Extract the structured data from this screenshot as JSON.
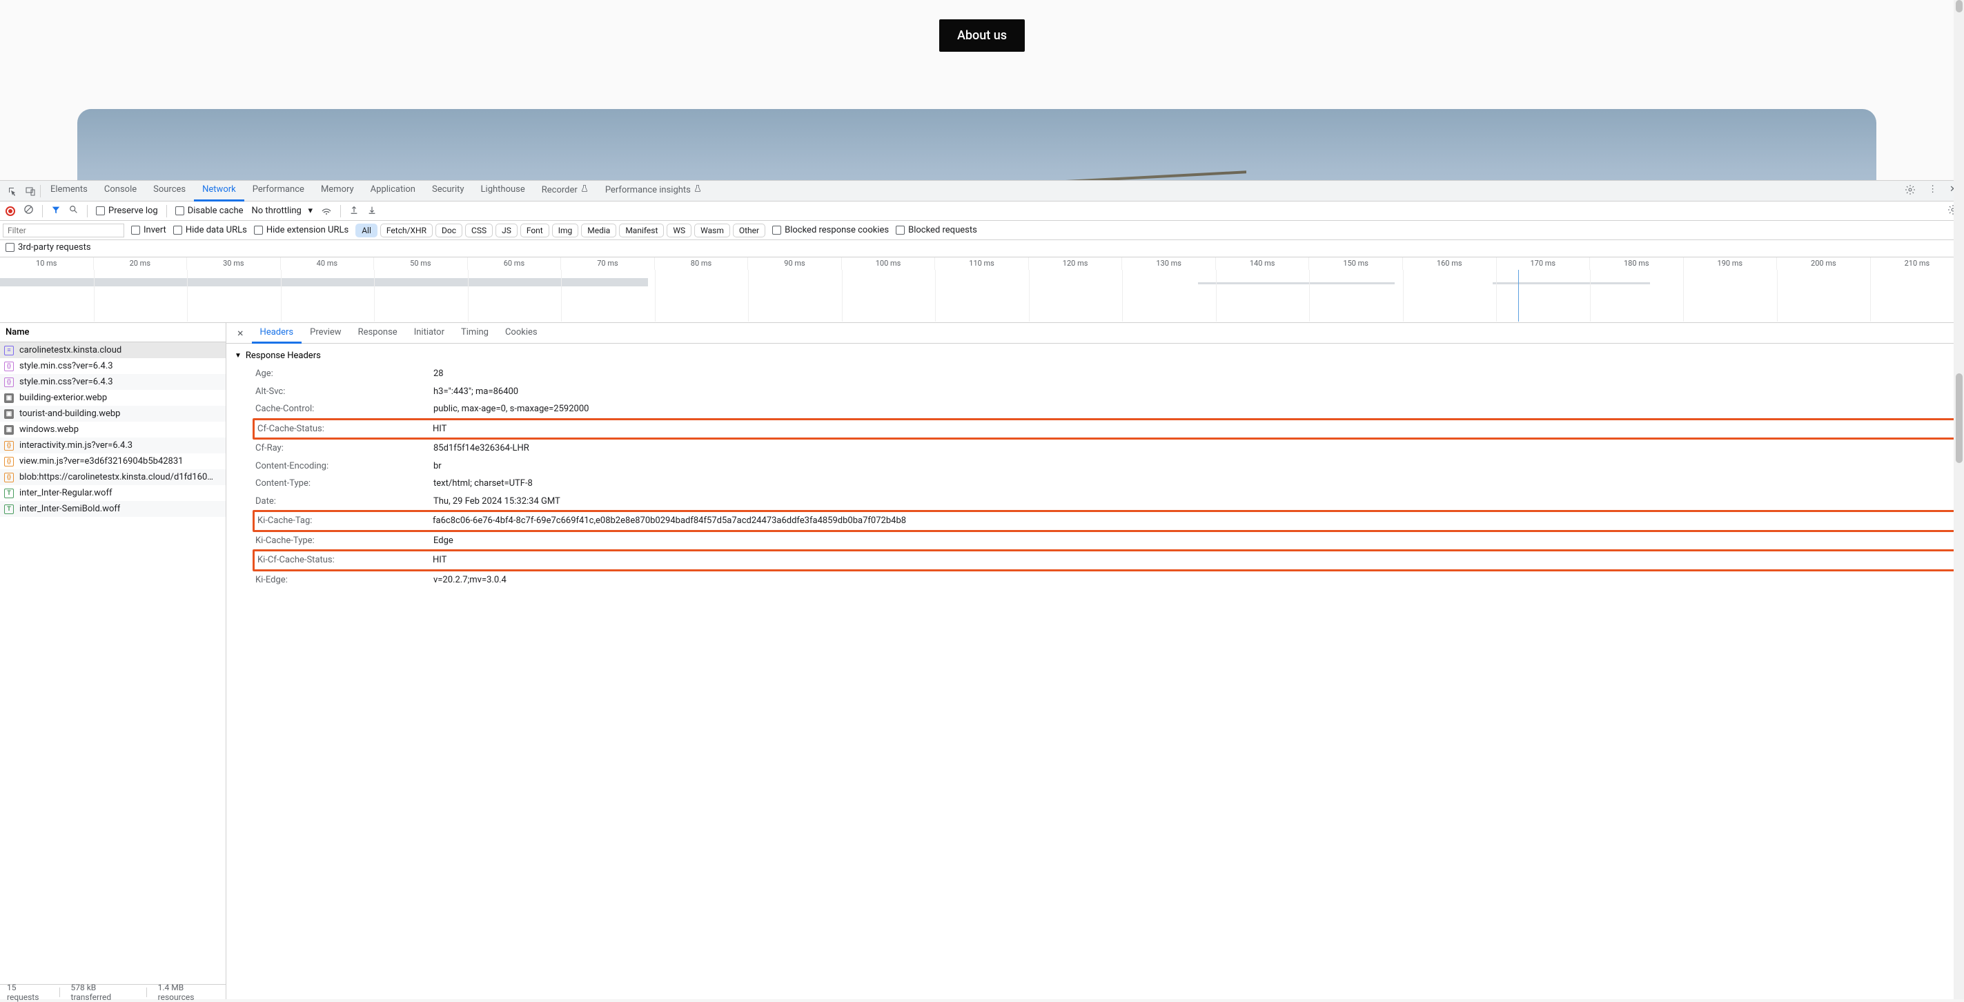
{
  "page": {
    "about_button": "About us"
  },
  "devtools": {
    "tabs": [
      "Elements",
      "Console",
      "Sources",
      "Network",
      "Performance",
      "Memory",
      "Application",
      "Security",
      "Lighthouse",
      "Recorder",
      "Performance insights"
    ],
    "active_tab": "Network"
  },
  "toolbar": {
    "preserve_log": "Preserve log",
    "disable_cache": "Disable cache",
    "throttling": "No throttling"
  },
  "filter": {
    "placeholder": "Filter",
    "invert": "Invert",
    "hide_data": "Hide data URLs",
    "hide_ext": "Hide extension URLs",
    "types": [
      "All",
      "Fetch/XHR",
      "Doc",
      "CSS",
      "JS",
      "Font",
      "Img",
      "Media",
      "Manifest",
      "WS",
      "Wasm",
      "Other"
    ],
    "active_type": "All",
    "blocked_cookies": "Blocked response cookies",
    "blocked_requests": "Blocked requests",
    "third_party": "3rd-party requests"
  },
  "timeline": {
    "ticks": [
      "10 ms",
      "20 ms",
      "30 ms",
      "40 ms",
      "50 ms",
      "60 ms",
      "70 ms",
      "80 ms",
      "90 ms",
      "100 ms",
      "110 ms",
      "120 ms",
      "130 ms",
      "140 ms",
      "150 ms",
      "160 ms",
      "170 ms",
      "180 ms",
      "190 ms",
      "200 ms",
      "210 ms"
    ]
  },
  "requests": {
    "header": "Name",
    "items": [
      {
        "type": "doc",
        "name": "carolinetestx.kinsta.cloud"
      },
      {
        "type": "css",
        "name": "style.min.css?ver=6.4.3"
      },
      {
        "type": "css",
        "name": "style.min.css?ver=6.4.3"
      },
      {
        "type": "img",
        "name": "building-exterior.webp"
      },
      {
        "type": "img",
        "name": "tourist-and-building.webp"
      },
      {
        "type": "img",
        "name": "windows.webp"
      },
      {
        "type": "js",
        "name": "interactivity.min.js?ver=6.4.3"
      },
      {
        "type": "js",
        "name": "view.min.js?ver=e3d6f3216904b5b42831"
      },
      {
        "type": "js",
        "name": "blob:https://carolinetestx.kinsta.cloud/d1fd160…"
      },
      {
        "type": "font",
        "name": "inter_Inter-Regular.woff"
      },
      {
        "type": "font",
        "name": "inter_Inter-SemiBold.woff"
      }
    ]
  },
  "status": {
    "requests": "15 requests",
    "transferred": "578 kB transferred",
    "resources": "1.4 MB resources"
  },
  "details": {
    "tabs": [
      "Headers",
      "Preview",
      "Response",
      "Initiator",
      "Timing",
      "Cookies"
    ],
    "active": "Headers",
    "section_title": "Response Headers",
    "headers": [
      {
        "k": "Age:",
        "v": "28",
        "hl": false
      },
      {
        "k": "Alt-Svc:",
        "v": "h3=\":443\"; ma=86400",
        "hl": false
      },
      {
        "k": "Cache-Control:",
        "v": "public, max-age=0, s-maxage=2592000",
        "hl": false
      },
      {
        "k": "Cf-Cache-Status:",
        "v": "HIT",
        "hl": true
      },
      {
        "k": "Cf-Ray:",
        "v": "85d1f5f14e326364-LHR",
        "hl": false
      },
      {
        "k": "Content-Encoding:",
        "v": "br",
        "hl": false
      },
      {
        "k": "Content-Type:",
        "v": "text/html; charset=UTF-8",
        "hl": false
      },
      {
        "k": "Date:",
        "v": "Thu, 29 Feb 2024 15:32:34 GMT",
        "hl": false
      },
      {
        "k": "Ki-Cache-Tag:",
        "v": "fa6c8c06-6e76-4bf4-8c7f-69e7c669f41c,e08b2e8e870b0294badf84f57d5a7acd24473a6ddfe3fa4859db0ba7f072b4b8",
        "hl": true
      },
      {
        "k": "Ki-Cache-Type:",
        "v": "Edge",
        "hl": false
      },
      {
        "k": "Ki-Cf-Cache-Status:",
        "v": "HIT",
        "hl": true
      },
      {
        "k": "Ki-Edge:",
        "v": "v=20.2.7;mv=3.0.4",
        "hl": false
      }
    ]
  }
}
